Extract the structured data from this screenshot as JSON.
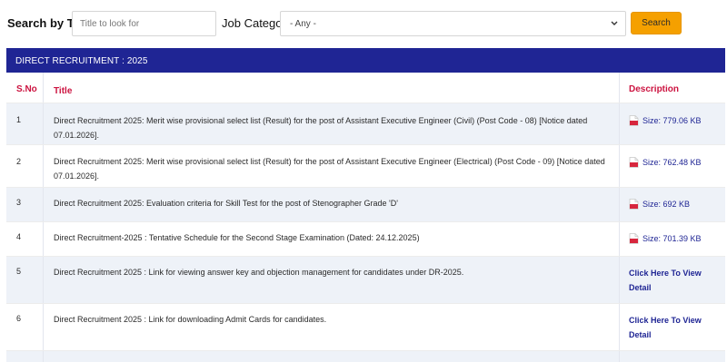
{
  "search": {
    "title_label": "Search by Title",
    "title_placeholder": "Title to look for",
    "category_label": "Job Category",
    "category_selected": "- Any -",
    "button_label": "Search"
  },
  "table": {
    "header": "DIRECT RECRUITMENT : 2025",
    "columns": {
      "sno": "S.No",
      "title": "Title",
      "description": "Description"
    },
    "rows": [
      {
        "sno": "1",
        "title": "Direct Recruitment 2025: Merit wise provisional select list (Result) for the post of Assistant Executive Engineer (Civil) (Post Code - 08) [Notice dated 07.01.2026].",
        "desc_type": "pdf",
        "desc": "Size: 779.06 KB"
      },
      {
        "sno": "2",
        "title": "Direct Recruitment 2025: Merit wise provisional select list (Result) for the post of Assistant Executive Engineer (Electrical) (Post Code - 09) [Notice dated 07.01.2026].",
        "desc_type": "pdf",
        "desc": "Size: 762.48 KB"
      },
      {
        "sno": "3",
        "title": "Direct Recruitment 2025: Evaluation criteria for Skill Test for the post of Stenographer Grade 'D'",
        "desc_type": "pdf",
        "desc": "Size: 692 KB"
      },
      {
        "sno": "4",
        "title": "Direct Recruitment-2025 : Tentative Schedule for the Second Stage Examination (Dated: 24.12.2025)",
        "desc_type": "pdf",
        "desc": "Size: 701.39 KB"
      },
      {
        "sno": "5",
        "title": "Direct Recruitment 2025 : Link for viewing answer key and objection management for candidates under DR-2025.",
        "desc_type": "link",
        "desc": "Click Here To View Detail"
      },
      {
        "sno": "6",
        "title": "Direct Recruitment 2025 : Link for downloading Admit Cards for candidates.",
        "desc_type": "link",
        "desc": "Click Here To View Detail"
      }
    ]
  },
  "icons": {
    "pdf": "pdf-file-icon",
    "select_arrow": "chevron-down-icon"
  },
  "colors": {
    "header_bg": "#1f2594",
    "column_header_text": "#cc1340",
    "link": "#1f2594",
    "search_button": "#f5a000",
    "alt_row": "#eef2f8"
  }
}
